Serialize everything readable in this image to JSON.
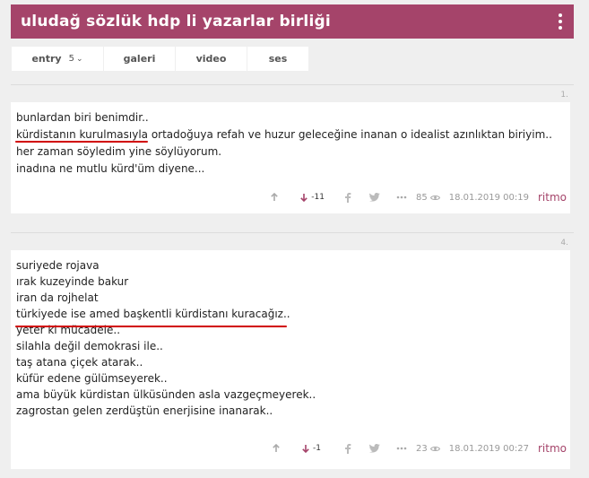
{
  "title": "uludağ sözlük hdp li yazarlar birliği",
  "tabs": [
    {
      "label": "entry",
      "count": "5"
    },
    {
      "label": "galeri"
    },
    {
      "label": "video"
    },
    {
      "label": "ses"
    }
  ],
  "entries": [
    {
      "number": "1.",
      "lines": [
        "bunlardan biri benimdir..",
        "kürdistanın kurulmasıyla ortadoğuya refah ve huzur geleceğine inanan o idealist azınlıktan biriyim..",
        "her zaman söyledim yine söylüyorum.",
        "inadına ne mutlu kürd'üm diyene..."
      ],
      "downvotes": "-11",
      "views": "85",
      "date": "18.01.2019 00:19",
      "author": "ritmo"
    },
    {
      "number": "4.",
      "lines": [
        "suriyede rojava",
        "ırak kuzeyinde bakur",
        "iran da rojhelat",
        "türkiyede ise amed başkentli kürdistanı kuracağız..",
        "yeter ki mücadele..",
        "silahla değil demokrasi ile..",
        "taş atana çiçek atarak..",
        "küfür edene gülümseyerek..",
        "ama büyük kürdistan ülküsünden asla vazgeçmeyerek..",
        "zagrostan gelen zerdüştün enerjisine inanarak.."
      ],
      "downvotes": "-1",
      "views": "23",
      "date": "18.01.2019 00:27",
      "author": "ritmo"
    }
  ],
  "colors": {
    "accent": "#a5446a",
    "underline": "#d10000",
    "downvote": "#a5446a"
  },
  "icons": [
    "menu-kebab-icon",
    "chevron-down-icon",
    "arrow-up-icon",
    "arrow-down-icon",
    "facebook-icon",
    "twitter-icon",
    "more-icon",
    "eye-icon"
  ]
}
